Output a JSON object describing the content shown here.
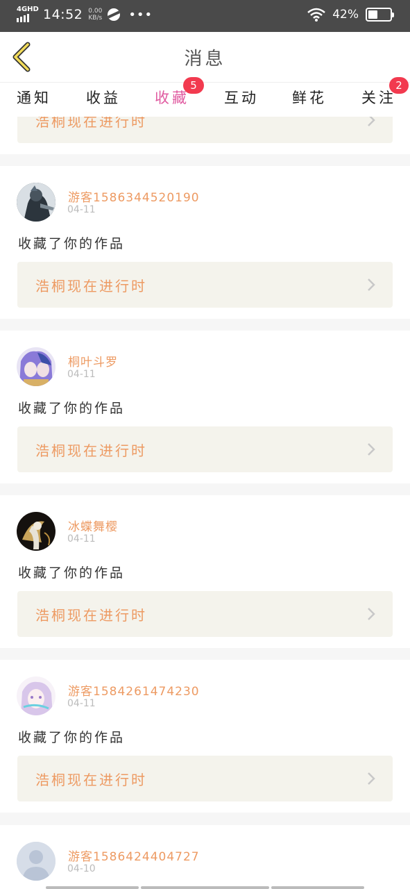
{
  "status_bar": {
    "network": "4GHD",
    "time": "14:52",
    "speed_value": "0.00",
    "speed_unit": "KB/s",
    "more": "•••",
    "battery_text": "42%",
    "battery_level": 0.42
  },
  "header": {
    "title": "消息",
    "back_icon": "chevron-left-icon"
  },
  "tabs": [
    {
      "label": "通知",
      "active": false
    },
    {
      "label": "收益",
      "active": false
    },
    {
      "label": "收藏",
      "active": true,
      "badge": "5"
    },
    {
      "label": "互动",
      "active": false
    },
    {
      "label": "鲜花",
      "active": false
    },
    {
      "label": "关注",
      "active": false,
      "badge": "2"
    }
  ],
  "colors": {
    "accent": "#e05aa0",
    "username": "#ed9a62",
    "badge": "#f23a4f",
    "work_bg": "#f4f3ec"
  },
  "partial_card": {
    "work_title": "浩桐现在进行时"
  },
  "notifications": [
    {
      "username": "游客1586344520190",
      "date": "04-11",
      "action": "收藏了你的作品",
      "work_title": "浩桐现在进行时",
      "avatar": "avatar-dark-figure"
    },
    {
      "username": "桐叶斗罗",
      "date": "04-11",
      "action": "收藏了你的作品",
      "work_title": "浩桐现在进行时",
      "avatar": "avatar-anime-purple"
    },
    {
      "username": "冰蝶舞樱",
      "date": "04-11",
      "action": "收藏了你的作品",
      "work_title": "浩桐现在进行时",
      "avatar": "avatar-anime-dark"
    },
    {
      "username": "游客1584261474230",
      "date": "04-11",
      "action": "收藏了你的作品",
      "work_title": "浩桐现在进行时",
      "avatar": "avatar-anime-light"
    },
    {
      "username": "游客1586424404727",
      "date": "04-10",
      "action": "",
      "work_title": "",
      "avatar": "default-avatar-icon"
    }
  ]
}
